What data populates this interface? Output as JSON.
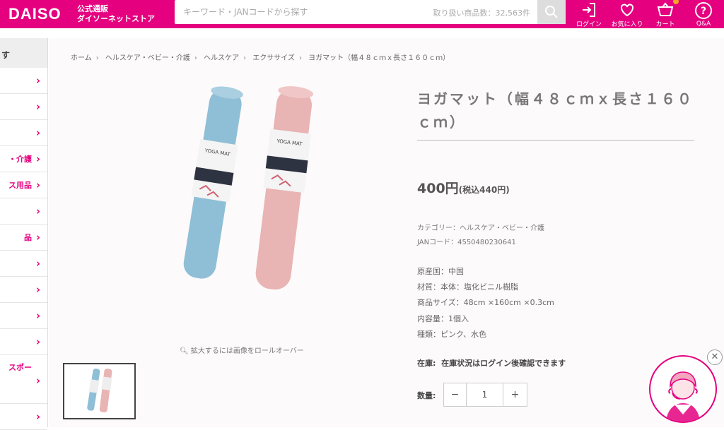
{
  "header": {
    "logo": "DAISO",
    "logo_sub_1": "公式通販",
    "logo_sub_2": "ダイソーネットストア",
    "search_placeholder": "キーワード・JANコードから探す",
    "product_count": "取り扱い商品数：32,563件",
    "icons": {
      "login": "ログイン",
      "favorites": "お気に入り",
      "cart": "カート",
      "qa": "Q&A"
    }
  },
  "sidebar": {
    "head": "す",
    "items": [
      {
        "label": ""
      },
      {
        "label": ""
      },
      {
        "label": ""
      },
      {
        "label": "・介護"
      },
      {
        "label": "ス用品"
      },
      {
        "label": ""
      },
      {
        "label": "品"
      },
      {
        "label": ""
      },
      {
        "label": ""
      },
      {
        "label": ""
      },
      {
        "label": ""
      },
      {
        "label": "スポー"
      },
      {
        "label": ""
      }
    ]
  },
  "breadcrumb": [
    "ホーム",
    "ヘルスケア・ベビー・介護",
    "ヘルスケア",
    "エクササイズ",
    "ヨガマット（幅４８ｃｍｘ長さ１６０ｃｍ）"
  ],
  "product": {
    "title": "ヨガマット（幅４８ｃｍｘ長さ１６０ｃｍ）",
    "price": "400円",
    "price_tax": "(税込440円)",
    "category": "カテゴリー：ヘルスケア・ベビー・介護",
    "jan": "JANコード：4550480230641",
    "origin": "原産国：中国",
    "material": "材質：本体：塩化ビニル樹脂",
    "size": "商品サイズ：48cm ×160cm ×0.3cm",
    "contents": "内容量：1個入",
    "type": "種類：ピンク、水色",
    "stock_label": "在庫:",
    "stock_value": "在庫状況はログイン後確認できます",
    "qty_label": "数量:",
    "qty_value": "1",
    "zoom_note": "拡大するには画像をロールオーバー",
    "package_text": "YOGA MAT"
  },
  "colors": {
    "brand": "#e4007f",
    "mat_blue": "#8fbfd6",
    "mat_pink": "#e8b4b4"
  }
}
